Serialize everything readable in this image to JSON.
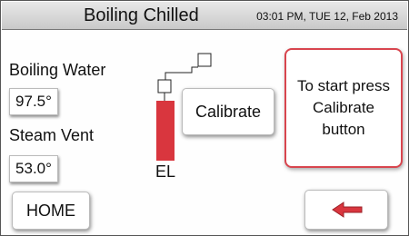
{
  "header": {
    "title": "Boiling Chilled",
    "datetime": "03:01 PM, TUE 12, Feb 2013"
  },
  "readings": {
    "boiling_water_label": "Boiling Water",
    "boiling_water_value": "97.5°",
    "steam_vent_label": "Steam Vent",
    "steam_vent_value": "53.0°"
  },
  "diagram": {
    "el_label": "EL",
    "bar_color": "#d9363e"
  },
  "buttons": {
    "calibrate_label": "Calibrate",
    "home_label": "HOME",
    "back_icon": "left-arrow-icon"
  },
  "instruction": {
    "text": "To start press\nCalibrate\nbutton"
  },
  "colors": {
    "accent_red": "#d9363e",
    "instruction_border": "#d8454e"
  }
}
